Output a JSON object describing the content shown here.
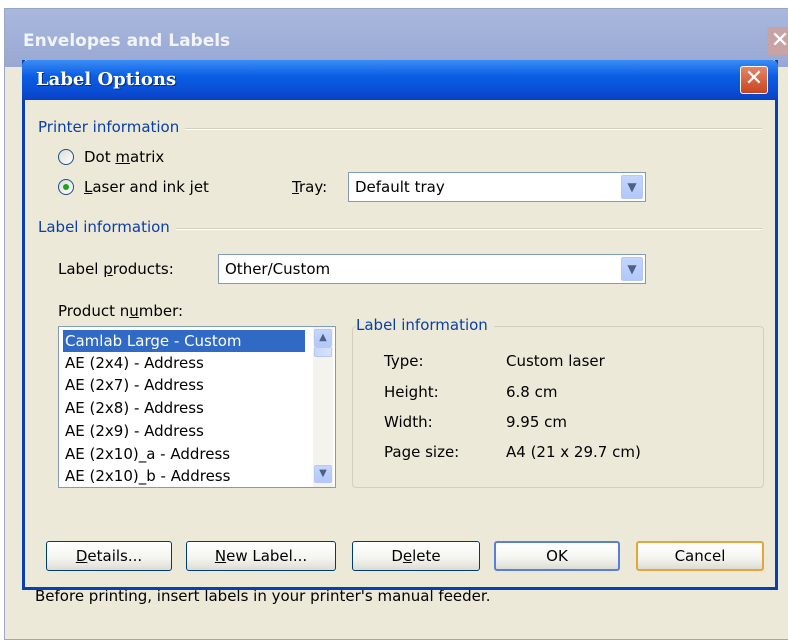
{
  "background_window": {
    "title": "Envelopes and Labels",
    "close_glyph": "✕",
    "hint_text": "Before printing, insert labels in your printer's manual feeder."
  },
  "dialog": {
    "title": "Label Options",
    "close_glyph": "✕"
  },
  "printer_information": {
    "group_label": "Printer information",
    "options": [
      {
        "label_pre": "Dot ",
        "label_key": "m",
        "label_post": "atrix",
        "selected": false
      },
      {
        "label_pre": "",
        "label_key": "L",
        "label_post": "aser and ink jet",
        "selected": true
      }
    ],
    "tray": {
      "label_key": "T",
      "label_post": "ray:",
      "value": "Default tray"
    }
  },
  "label_information": {
    "group_label": "Label information",
    "label_products": {
      "label_pre": "Label ",
      "label_key": "p",
      "label_post": "roducts:",
      "value": "Other/Custom"
    },
    "product_number": {
      "label_pre": "Product n",
      "label_key": "u",
      "label_post": "mber:",
      "items": [
        {
          "text": "Camlab Large - Custom",
          "selected": true
        },
        {
          "text": "AE (2x4) - Address",
          "selected": false
        },
        {
          "text": "AE (2x7) - Address",
          "selected": false
        },
        {
          "text": "AE (2x8) - Address",
          "selected": false
        },
        {
          "text": "AE (2x9) - Address",
          "selected": false
        },
        {
          "text": "AE (2x10)_a - Address",
          "selected": false
        },
        {
          "text": "AE (2x10)_b - Address",
          "selected": false
        }
      ]
    },
    "details": {
      "group_label": "Label information",
      "rows": [
        {
          "label": "Type:",
          "value": "Custom laser"
        },
        {
          "label": "Height:",
          "value": "6.8 cm"
        },
        {
          "label": "Width:",
          "value": "9.95 cm"
        },
        {
          "label": "Page size:",
          "value": "A4 (21 x 29.7 cm)"
        }
      ]
    }
  },
  "buttons": {
    "details": {
      "key": "D",
      "rest": "etails..."
    },
    "new_label": {
      "key": "N",
      "rest": "ew Label..."
    },
    "delete": {
      "pre": "D",
      "key": "e",
      "rest": "lete"
    },
    "ok": {
      "label": "OK"
    },
    "cancel": {
      "label": "Cancel"
    }
  },
  "icons": {
    "dropdown": "chevron-down-icon",
    "scroll_up": "scroll-up-icon",
    "scroll_down": "scroll-down-icon",
    "close": "close-icon"
  },
  "colors": {
    "titlebar": "#0a5ee3",
    "selection": "#316ac5",
    "group_text": "#0a3fa6",
    "dialog_bg": "#ece9d8"
  }
}
